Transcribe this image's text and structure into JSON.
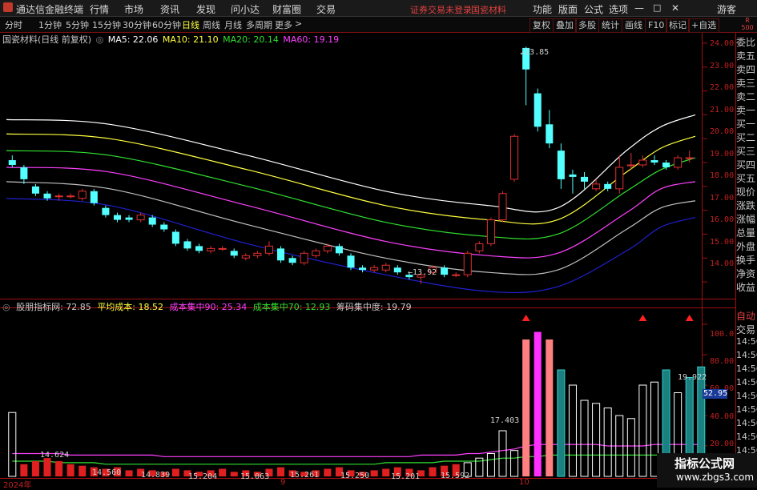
{
  "app": {
    "title": "通达信金融终端",
    "menu": [
      "行情",
      "市场",
      "资讯",
      "发现",
      "问小达",
      "财富圈",
      "交易"
    ],
    "status_msg": "证券交易未登录",
    "stock_name_header": "国瓷材料",
    "right_menu": [
      "功能",
      "版面",
      "公式",
      "选项"
    ],
    "guest": "游客",
    "window_controls": [
      "—",
      "□",
      "✕"
    ]
  },
  "periods": {
    "items": [
      "分时",
      "1分钟",
      "5分钟",
      "15分钟",
      "30分钟",
      "60分钟",
      "日线",
      "周线",
      "月线",
      "多周期",
      "更多"
    ],
    "active": "日线",
    "right_buttons": [
      "复权",
      "叠加",
      "多股",
      "统计",
      "画线",
      "F10",
      "标记",
      "+自选"
    ],
    "corner": "R 500"
  },
  "main_info": {
    "stock_title": "国瓷材料(日线 前复权)",
    "ma5": "MA5: 22.06",
    "ma10": "MA10: 21.10",
    "ma20": "MA20: 20.14",
    "ma60": "MA60: 19.19"
  },
  "indicator_info": {
    "name": "股朋指标网",
    "val": ": 72.85",
    "avg_cost": "平均成本: 18.52",
    "c90": "成本集中90: 25.34",
    "c70": "成本集中70: 12.93",
    "conc": "筹码集中度: 19.79"
  },
  "price_axis": [
    "24.00",
    "23.00",
    "22.00",
    "21.00",
    "20.00",
    "19.00",
    "18.00",
    "17.00",
    "16.00",
    "15.00",
    "14.00"
  ],
  "ind_axis": [
    "100.0",
    "80.00",
    "60.00",
    "40.00",
    "20.00"
  ],
  "ind_current": "52.95",
  "side_panel": [
    "委比",
    "卖五",
    "卖四",
    "卖三",
    "卖二",
    "卖一",
    "买一",
    "买二",
    "买三",
    "买四",
    "买五",
    "现价",
    "涨跌",
    "涨幅",
    "总量",
    "外盘",
    "换手",
    "净资",
    "收益"
  ],
  "side_bottom": [
    "自动",
    "交易",
    "14:56",
    "14:56",
    "14:56",
    "14:56",
    "14:56",
    "14:56",
    "14:56",
    "14:56",
    "14:56"
  ],
  "annotations": {
    "high": "23.85",
    "low": "13.92",
    "i1": "14.624",
    "i2": "14.560",
    "i3": "14.839",
    "i4": "15.204",
    "i5": "15.063",
    "i6": "15.261",
    "i7": "15.250",
    "i8": "15.201",
    "i9": "15.592",
    "i10": "17.403",
    "i11": "19.922"
  },
  "x_axis": [
    "2024年",
    "9",
    "10"
  ],
  "watermark": {
    "line1": "指标公式网",
    "line2": "www.zbgs3.com"
  },
  "colors": {
    "up": "#e03030",
    "down": "#54ffff",
    "ma5": "#ffffff",
    "ma10": "#ffff40",
    "ma20": "#30e030",
    "ma60": "#ff40ff",
    "axis": "#c02020",
    "band_low": "#2020d0"
  },
  "chart_data": {
    "type": "candlestick",
    "ylim": [
      13.4,
      24.4
    ],
    "candles": [
      {
        "o": 19.1,
        "c": 18.9,
        "h": 19.3,
        "l": 18.8
      },
      {
        "o": 18.8,
        "c": 18.3,
        "h": 18.9,
        "l": 18.1
      },
      {
        "o": 18.0,
        "c": 17.7,
        "h": 18.1,
        "l": 17.6
      },
      {
        "o": 17.7,
        "c": 17.5,
        "h": 17.8,
        "l": 17.4
      },
      {
        "o": 17.6,
        "c": 17.6,
        "h": 17.7,
        "l": 17.4
      },
      {
        "o": 17.6,
        "c": 17.6,
        "h": 17.7,
        "l": 17.5
      },
      {
        "o": 17.5,
        "c": 17.8,
        "h": 17.9,
        "l": 17.4
      },
      {
        "o": 17.8,
        "c": 17.3,
        "h": 17.9,
        "l": 17.2
      },
      {
        "o": 17.1,
        "c": 16.8,
        "h": 17.2,
        "l": 16.7
      },
      {
        "o": 16.8,
        "c": 16.6,
        "h": 16.9,
        "l": 16.5
      },
      {
        "o": 16.7,
        "c": 16.6,
        "h": 16.8,
        "l": 16.5
      },
      {
        "o": 16.6,
        "c": 16.8,
        "h": 16.9,
        "l": 16.5
      },
      {
        "o": 16.7,
        "c": 16.4,
        "h": 16.8,
        "l": 16.3
      },
      {
        "o": 16.4,
        "c": 16.2,
        "h": 16.5,
        "l": 16.1
      },
      {
        "o": 16.1,
        "c": 15.6,
        "h": 16.2,
        "l": 15.5
      },
      {
        "o": 15.7,
        "c": 15.4,
        "h": 15.8,
        "l": 15.3
      },
      {
        "o": 15.5,
        "c": 15.3,
        "h": 15.6,
        "l": 15.2
      },
      {
        "o": 15.3,
        "c": 15.4,
        "h": 15.5,
        "l": 15.2
      },
      {
        "o": 15.4,
        "c": 15.4,
        "h": 15.5,
        "l": 15.3
      },
      {
        "o": 15.3,
        "c": 15.1,
        "h": 15.4,
        "l": 15.0
      },
      {
        "o": 15.0,
        "c": 15.1,
        "h": 15.2,
        "l": 14.9
      },
      {
        "o": 15.1,
        "c": 15.2,
        "h": 15.3,
        "l": 15.0
      },
      {
        "o": 15.2,
        "c": 15.5,
        "h": 15.7,
        "l": 15.1
      },
      {
        "o": 15.4,
        "c": 14.9,
        "h": 15.5,
        "l": 14.8
      },
      {
        "o": 15.0,
        "c": 14.8,
        "h": 15.1,
        "l": 14.7
      },
      {
        "o": 14.8,
        "c": 15.2,
        "h": 15.3,
        "l": 14.7
      },
      {
        "o": 15.1,
        "c": 15.3,
        "h": 15.4,
        "l": 15.0
      },
      {
        "o": 15.3,
        "c": 15.5,
        "h": 15.6,
        "l": 15.2
      },
      {
        "o": 15.5,
        "c": 15.2,
        "h": 15.6,
        "l": 15.1
      },
      {
        "o": 15.1,
        "c": 14.6,
        "h": 15.2,
        "l": 14.5
      },
      {
        "o": 14.6,
        "c": 14.5,
        "h": 14.7,
        "l": 14.4
      },
      {
        "o": 14.5,
        "c": 14.6,
        "h": 14.7,
        "l": 14.4
      },
      {
        "o": 14.5,
        "c": 14.7,
        "h": 14.8,
        "l": 14.4
      },
      {
        "o": 14.6,
        "c": 14.4,
        "h": 14.7,
        "l": 14.3
      },
      {
        "o": 14.3,
        "c": 14.2,
        "h": 14.4,
        "l": 14.1
      },
      {
        "o": 14.2,
        "c": 14.3,
        "h": 14.4,
        "l": 13.92
      },
      {
        "o": 14.4,
        "c": 14.6,
        "h": 14.7,
        "l": 14.3
      },
      {
        "o": 14.6,
        "c": 14.3,
        "h": 14.7,
        "l": 14.2
      },
      {
        "o": 14.3,
        "c": 14.3,
        "h": 14.4,
        "l": 14.2
      },
      {
        "o": 14.3,
        "c": 15.2,
        "h": 15.3,
        "l": 14.2
      },
      {
        "o": 15.3,
        "c": 15.6,
        "h": 15.7,
        "l": 15.2
      },
      {
        "o": 15.6,
        "c": 16.6,
        "h": 16.7,
        "l": 15.5
      },
      {
        "o": 16.6,
        "c": 17.7,
        "h": 17.8,
        "l": 16.5
      },
      {
        "o": 18.3,
        "c": 20.1,
        "h": 20.2,
        "l": 18.2
      },
      {
        "o": 23.8,
        "c": 22.9,
        "h": 23.85,
        "l": 21.4
      },
      {
        "o": 21.9,
        "c": 20.5,
        "h": 22.1,
        "l": 20.3
      },
      {
        "o": 20.6,
        "c": 19.8,
        "h": 21.2,
        "l": 19.6
      },
      {
        "o": 19.5,
        "c": 18.3,
        "h": 19.8,
        "l": 17.9
      },
      {
        "o": 18.5,
        "c": 18.4,
        "h": 18.7,
        "l": 17.7
      },
      {
        "o": 18.4,
        "c": 18.2,
        "h": 18.6,
        "l": 17.9
      },
      {
        "o": 17.9,
        "c": 18.1,
        "h": 18.3,
        "l": 17.8
      },
      {
        "o": 18.1,
        "c": 17.9,
        "h": 18.2,
        "l": 17.8
      },
      {
        "o": 17.9,
        "c": 18.8,
        "h": 19.3,
        "l": 17.7
      },
      {
        "o": 18.9,
        "c": 18.9,
        "h": 19.4,
        "l": 18.7
      },
      {
        "o": 18.9,
        "c": 19.1,
        "h": 19.3,
        "l": 18.8
      },
      {
        "o": 19.1,
        "c": 19.0,
        "h": 19.3,
        "l": 18.9
      },
      {
        "o": 19.0,
        "c": 18.8,
        "h": 19.1,
        "l": 18.7
      },
      {
        "o": 18.8,
        "c": 19.2,
        "h": 19.3,
        "l": 18.7
      },
      {
        "o": 19.2,
        "c": 19.2,
        "h": 19.5,
        "l": 19.0
      }
    ],
    "bands_t": [
      0,
      0.15,
      0.35,
      0.55,
      0.7,
      0.8,
      0.9,
      0.95,
      1.0
    ],
    "bands": [
      {
        "name": "b1",
        "color": "#ffffff",
        "values": [
          20.8,
          20.6,
          19.3,
          17.8,
          17.2,
          17.1,
          19.5,
          20.5,
          21.0
        ]
      },
      {
        "name": "b2",
        "color": "#ffff40",
        "values": [
          20.2,
          20.0,
          18.7,
          17.2,
          16.6,
          16.6,
          18.6,
          19.6,
          20.1
        ]
      },
      {
        "name": "b3",
        "color": "#30e030",
        "values": [
          19.5,
          19.3,
          18.0,
          16.5,
          15.9,
          16.0,
          17.8,
          18.7,
          19.2
        ]
      },
      {
        "name": "b4",
        "color": "#ff40ff",
        "values": [
          18.8,
          18.6,
          17.2,
          15.7,
          15.1,
          15.2,
          16.9,
          17.9,
          18.2
        ]
      },
      {
        "name": "b5",
        "color": "#c0c0c0",
        "values": [
          18.2,
          17.9,
          16.4,
          15.0,
          14.4,
          14.5,
          16.2,
          17.1,
          17.4
        ]
      },
      {
        "name": "b6",
        "color": "#2020d0",
        "values": [
          17.5,
          17.2,
          15.6,
          14.3,
          13.6,
          13.8,
          15.3,
          16.3,
          16.7
        ]
      }
    ],
    "indicator": {
      "ylim": [
        0,
        110
      ],
      "bars": [
        42,
        8,
        10,
        12,
        10,
        8,
        7,
        6,
        5,
        6,
        4,
        5,
        4,
        3,
        5,
        4,
        3,
        4,
        5,
        3,
        4,
        3,
        5,
        6,
        4,
        3,
        4,
        5,
        6,
        4,
        3,
        4,
        5,
        6,
        5,
        4,
        6,
        7,
        8,
        9,
        12,
        15,
        30,
        17,
        90,
        95,
        90,
        70,
        60,
        50,
        48,
        45,
        40,
        38,
        60,
        62,
        70,
        55,
        65,
        72
      ],
      "colors": [
        "white",
        "red",
        "red",
        "red",
        "red",
        "red",
        "red",
        "red",
        "red",
        "red",
        "red",
        "red",
        "red",
        "red",
        "red",
        "red",
        "red",
        "red",
        "red",
        "red",
        "red",
        "red",
        "red",
        "red",
        "red",
        "red",
        "red",
        "red",
        "red",
        "red",
        "red",
        "red",
        "red",
        "red",
        "red",
        "red",
        "red",
        "red",
        "red",
        "white",
        "white",
        "white",
        "white",
        "white",
        "pink",
        "magenta",
        "pink",
        "cyan",
        "white",
        "white",
        "white",
        "white",
        "white",
        "white",
        "white",
        "white",
        "cyan",
        "white",
        "cyan",
        "cyan"
      ],
      "signals": [
        44,
        54,
        58
      ],
      "line_purple": [
        15,
        15,
        15,
        15,
        15,
        14,
        14,
        14,
        14,
        14,
        14,
        14,
        14,
        13,
        13,
        13,
        13,
        13,
        13,
        13,
        13,
        13,
        13,
        13,
        13,
        13,
        13,
        13,
        13,
        13,
        13,
        13,
        13,
        13,
        13,
        14,
        14,
        14,
        14,
        15,
        15,
        16,
        17,
        18,
        20,
        21,
        21,
        21,
        21,
        21,
        21,
        20,
        20,
        20,
        20,
        21,
        21,
        21,
        21,
        21
      ],
      "line_green": [
        10,
        10,
        10,
        10,
        9,
        9,
        9,
        9,
        8,
        8,
        8,
        8,
        8,
        8,
        8,
        8,
        8,
        8,
        8,
        8,
        8,
        8,
        8,
        8,
        8,
        8,
        8,
        8,
        8,
        8,
        8,
        8,
        9,
        9,
        9,
        9,
        9,
        10,
        10,
        10,
        10,
        11,
        12,
        12,
        13,
        13,
        14,
        14,
        14,
        14,
        14,
        14,
        14,
        14,
        14,
        14,
        14,
        14,
        14,
        14
      ]
    }
  }
}
